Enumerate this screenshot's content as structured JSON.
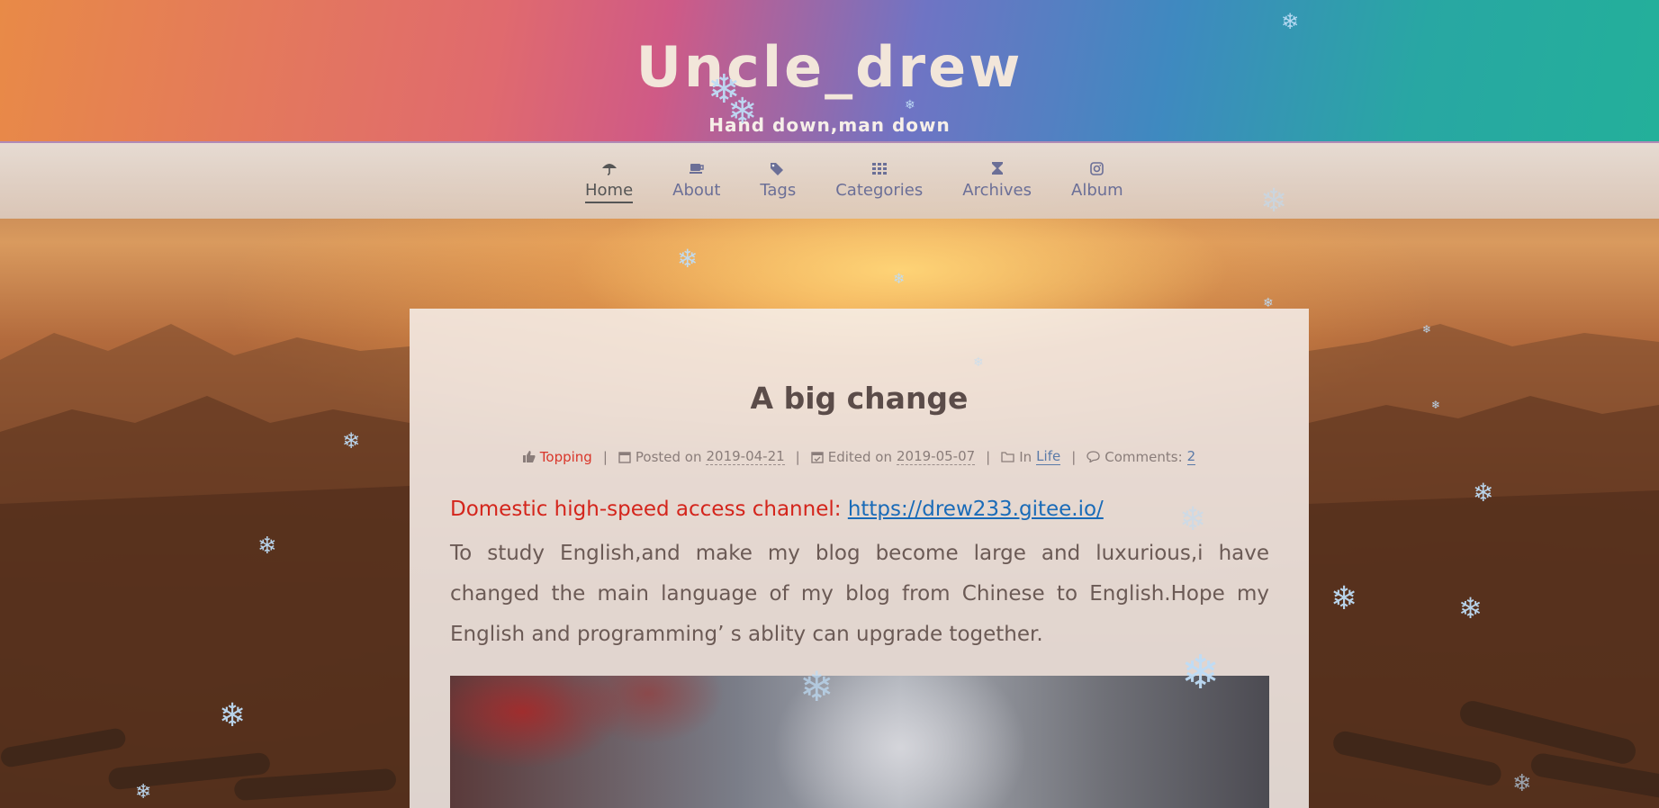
{
  "site": {
    "title": "Uncle_drew",
    "subtitle": "Hand down,man down"
  },
  "nav": {
    "items": [
      {
        "label": "Home",
        "icon": "umbrella-icon",
        "active": true
      },
      {
        "label": "About",
        "icon": "coffee-icon"
      },
      {
        "label": "Tags",
        "icon": "tags-icon"
      },
      {
        "label": "Categories",
        "icon": "grid-icon"
      },
      {
        "label": "Archives",
        "icon": "hourglass-icon"
      },
      {
        "label": "Album",
        "icon": "camera-icon"
      }
    ]
  },
  "post": {
    "title": "A big change",
    "meta": {
      "topping": "Topping",
      "posted_prefix": "Posted on",
      "posted_date": "2019-04-21",
      "edited_prefix": "Edited on",
      "edited_date": "2019-05-07",
      "category_prefix": "In",
      "category": "Life",
      "comments_prefix": "Comments:",
      "comments_count": "2",
      "separator": "|"
    },
    "intro_label": "Domestic high-speed access channel: ",
    "intro_link": "https://drew233.gitee.io/",
    "body": "To study English,and make my blog become large and luxurious,i have changed the main language of my blog from Chinese to English.Hope my English and programming’ s ablity can upgrade together."
  },
  "colors": {
    "topping": "#d9362a",
    "intro": "#d4251c",
    "link": "#1a6bb8",
    "nav_text": "#6b6f97"
  },
  "decorations": {
    "snowflake_glyph": "❄"
  }
}
